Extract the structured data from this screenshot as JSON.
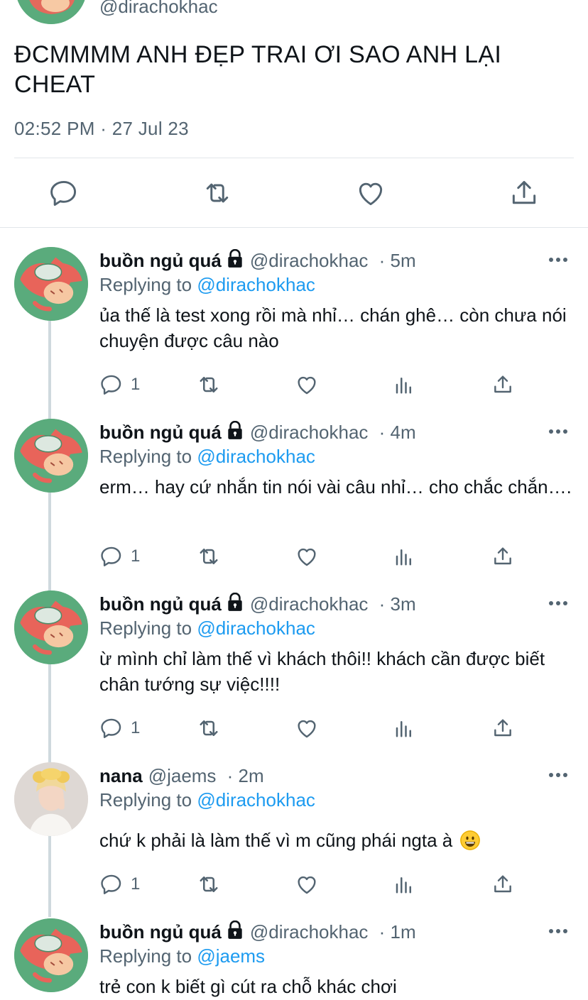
{
  "main_tweet": {
    "handle": "@dirachokhac",
    "text": "ĐCMMMM ANH ĐẸP TRAI ƠI SAO ANH LẠI CHEAT",
    "time": "02:52 PM",
    "separator": "·",
    "date": "27 Jul 23",
    "actions": [
      "reply-icon",
      "retweet-icon",
      "like-icon",
      "share-icon"
    ]
  },
  "replies": [
    {
      "name": "buồn ngủ quá",
      "locked": true,
      "handle": "@dirachokhac",
      "time": "· 5m",
      "replying_label": "Replying to",
      "replying_to": "@dirachokhac",
      "text": "ủa thế là test xong rồi mà nhỉ… chán ghê… còn chưa nói chuyện được câu nào",
      "reply_count": "1"
    },
    {
      "name": "buồn ngủ quá",
      "locked": true,
      "handle": "@dirachokhac",
      "time": "· 4m",
      "replying_label": "Replying to",
      "replying_to": "@dirachokhac",
      "text": "erm… hay cứ nhắn tin nói vài câu nhỉ… cho chắc chắn….",
      "reply_count": "1"
    },
    {
      "name": "buồn ngủ quá",
      "locked": true,
      "handle": "@dirachokhac",
      "time": "· 3m",
      "replying_label": "Replying to",
      "replying_to": "@dirachokhac",
      "text": "ừ mình chỉ làm thế vì khách thôi!! khách cần được biết chân tướng sự việc!!!!",
      "reply_count": "1"
    },
    {
      "name": "nana",
      "locked": false,
      "handle": "@jaems",
      "time": "· 2m",
      "replying_label": "Replying to",
      "replying_to": "@dirachokhac",
      "text": "chứ k phải là làm thế vì m cũng phái ngta à",
      "reply_count": "1"
    },
    {
      "name": "buồn ngủ quá",
      "locked": true,
      "handle": "@dirachokhac",
      "time": "· 1m",
      "replying_label": "Replying to",
      "replying_to": "@jaems",
      "text": "trẻ con k biết gì cút ra chỗ khác chơi"
    }
  ],
  "colors": {
    "link": "#1d9bf0",
    "secondary_text": "#536471",
    "avatar_green": "#5aab7c"
  }
}
